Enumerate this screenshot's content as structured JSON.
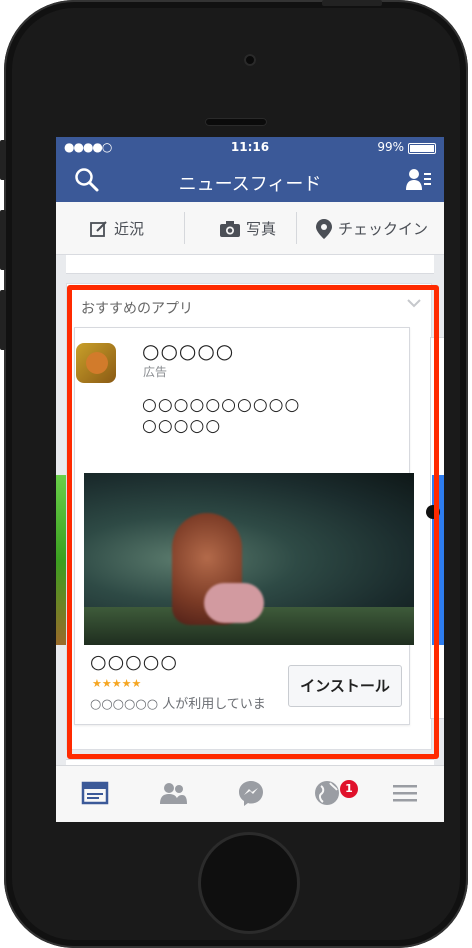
{
  "status_bar": {
    "signal": "●●●●○",
    "time": "11:16",
    "battery": "99%"
  },
  "nav": {
    "title": "ニュースフィード"
  },
  "composer": {
    "status_label": "近況",
    "photo_label": "写真",
    "checkin_label": "チェックイン"
  },
  "suggested": {
    "header": "おすすめのアプリ",
    "app_title": "○○○○○",
    "ad_label": "広告",
    "description_line1": "○○○○○○○○○○",
    "description_line2": "○○○○○",
    "footer_title": "○○○○○",
    "stars": "★★★★★",
    "usage_text": "○○○○○○ 人が利用していま",
    "install_label": "インストール"
  },
  "tabbar": {
    "badge_count": "1"
  },
  "colors": {
    "facebook_blue": "#3b5998",
    "highlight_red": "#ff2a00",
    "star_color": "#f5a623",
    "badge_red": "#e0112b"
  }
}
